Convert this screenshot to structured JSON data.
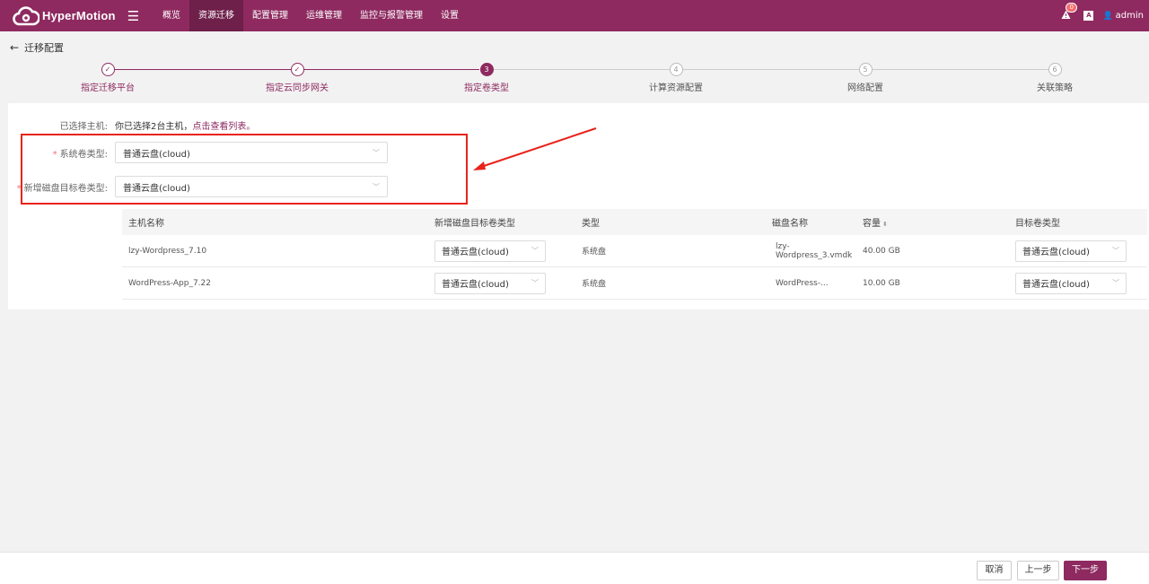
{
  "app": {
    "name": "HyperMotion"
  },
  "nav": {
    "items": [
      {
        "label": "概览",
        "active": false
      },
      {
        "label": "资源迁移",
        "active": true
      },
      {
        "label": "配置管理",
        "active": false
      },
      {
        "label": "运维管理",
        "active": false
      },
      {
        "label": "监控与报警管理",
        "active": false
      },
      {
        "label": "设置",
        "active": false
      }
    ]
  },
  "topright": {
    "alert_count": "0",
    "lang": "A",
    "user": "admin"
  },
  "page": {
    "title": "迁移配置"
  },
  "steps": [
    {
      "index": "1",
      "label": "指定迁移平台",
      "state": "done"
    },
    {
      "index": "2",
      "label": "指定云同步网关",
      "state": "done"
    },
    {
      "index": "3",
      "label": "指定卷类型",
      "state": "current"
    },
    {
      "index": "4",
      "label": "计算资源配置",
      "state": "todo"
    },
    {
      "index": "5",
      "label": "网络配置",
      "state": "todo"
    },
    {
      "index": "6",
      "label": "关联策略",
      "state": "todo"
    }
  ],
  "selected": {
    "label": "已选择主机:",
    "text": "你已选择2台主机，",
    "link": "点击查看列表。"
  },
  "form": {
    "system_volume": {
      "label": "系统卷类型:",
      "value": "普通云盘(cloud)"
    },
    "new_disk_volume": {
      "label": "新增磁盘目标卷类型:",
      "value": "普通云盘(cloud)"
    }
  },
  "table": {
    "headers": [
      "主机名称",
      "新增磁盘目标卷类型",
      "类型",
      "磁盘名称",
      "容量",
      "目标卷类型"
    ],
    "rows": [
      {
        "host": "lzy-Wordpress_7.10",
        "new_disk_type": "普通云盘(cloud)",
        "type": "系统盘",
        "disk": "lzy-Wordpress_3.vmdk",
        "capacity": "40.00 GB",
        "target_type": "普通云盘(cloud)"
      },
      {
        "host": "WordPress-App_7.22",
        "new_disk_type": "普通云盘(cloud)",
        "type": "系统盘",
        "disk": "WordPress-...",
        "capacity": "10.00 GB",
        "target_type": "普通云盘(cloud)"
      }
    ]
  },
  "footer": {
    "cancel": "取消",
    "prev": "上一步",
    "next": "下一步"
  },
  "colors": {
    "brand": "#8e2a60",
    "highlight": "#e8231c"
  }
}
